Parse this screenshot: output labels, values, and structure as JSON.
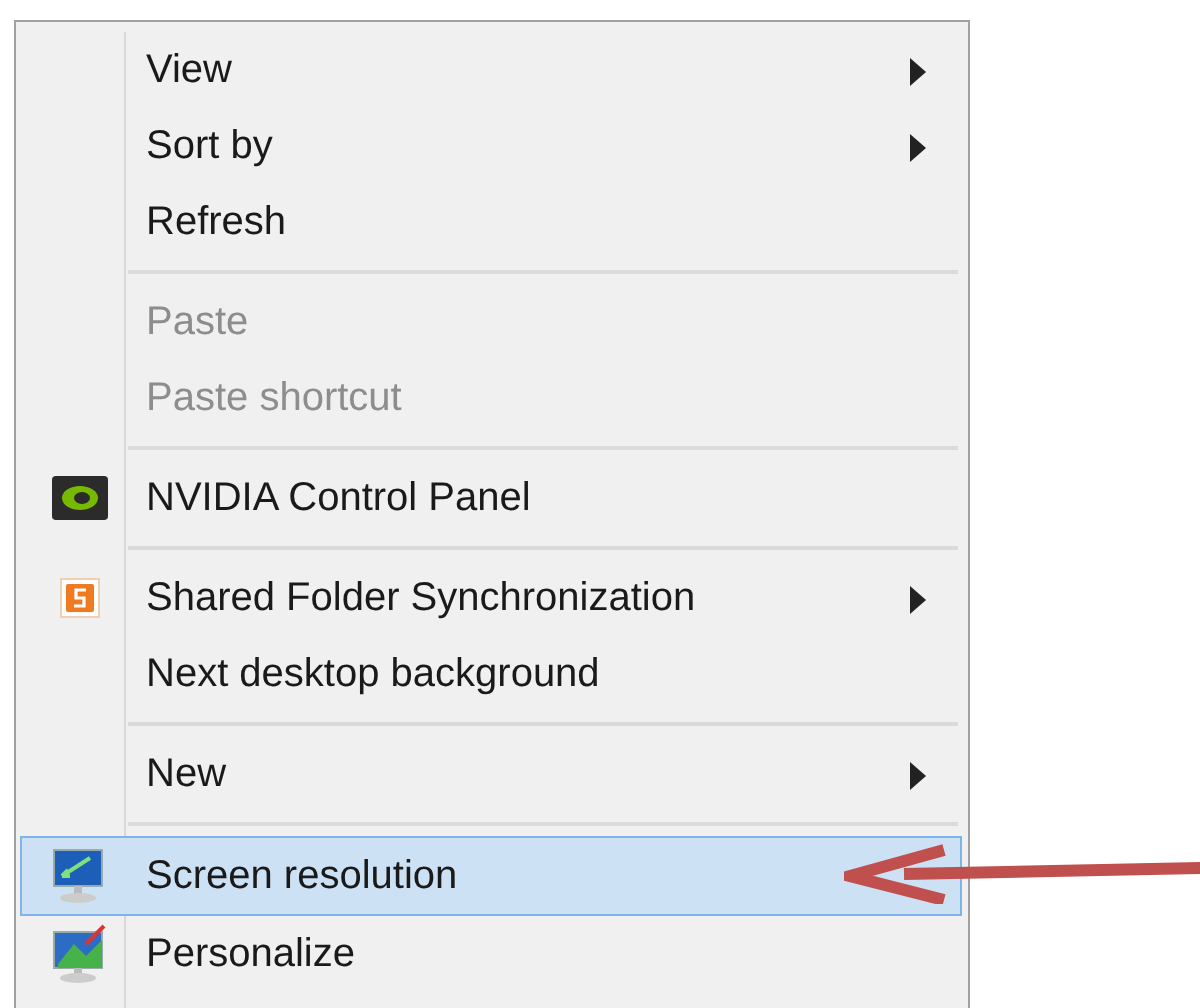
{
  "menu": {
    "items": [
      {
        "kind": "item",
        "label": "View",
        "disabled": false,
        "submenu": true,
        "selected": false
      },
      {
        "kind": "item",
        "label": "Sort by",
        "disabled": false,
        "submenu": true,
        "selected": false
      },
      {
        "kind": "item",
        "label": "Refresh",
        "disabled": false,
        "submenu": false,
        "selected": false
      },
      {
        "kind": "separator"
      },
      {
        "kind": "item",
        "label": "Paste",
        "disabled": true,
        "submenu": false,
        "selected": false
      },
      {
        "kind": "item",
        "label": "Paste shortcut",
        "disabled": true,
        "submenu": false,
        "selected": false
      },
      {
        "kind": "separator"
      },
      {
        "kind": "item",
        "label": "NVIDIA Control Panel",
        "disabled": false,
        "submenu": false,
        "selected": false
      },
      {
        "kind": "separator"
      },
      {
        "kind": "item",
        "label": "Shared Folder Synchronization",
        "disabled": false,
        "submenu": true,
        "selected": false
      },
      {
        "kind": "item",
        "label": "Next desktop background",
        "disabled": false,
        "submenu": false,
        "selected": false
      },
      {
        "kind": "separator"
      },
      {
        "kind": "item",
        "label": "New",
        "disabled": false,
        "submenu": true,
        "selected": false
      },
      {
        "kind": "separator"
      },
      {
        "kind": "item",
        "label": "Screen resolution",
        "disabled": false,
        "submenu": false,
        "selected": true
      },
      {
        "kind": "item",
        "label": "Personalize",
        "disabled": false,
        "submenu": false,
        "selected": false
      }
    ]
  }
}
